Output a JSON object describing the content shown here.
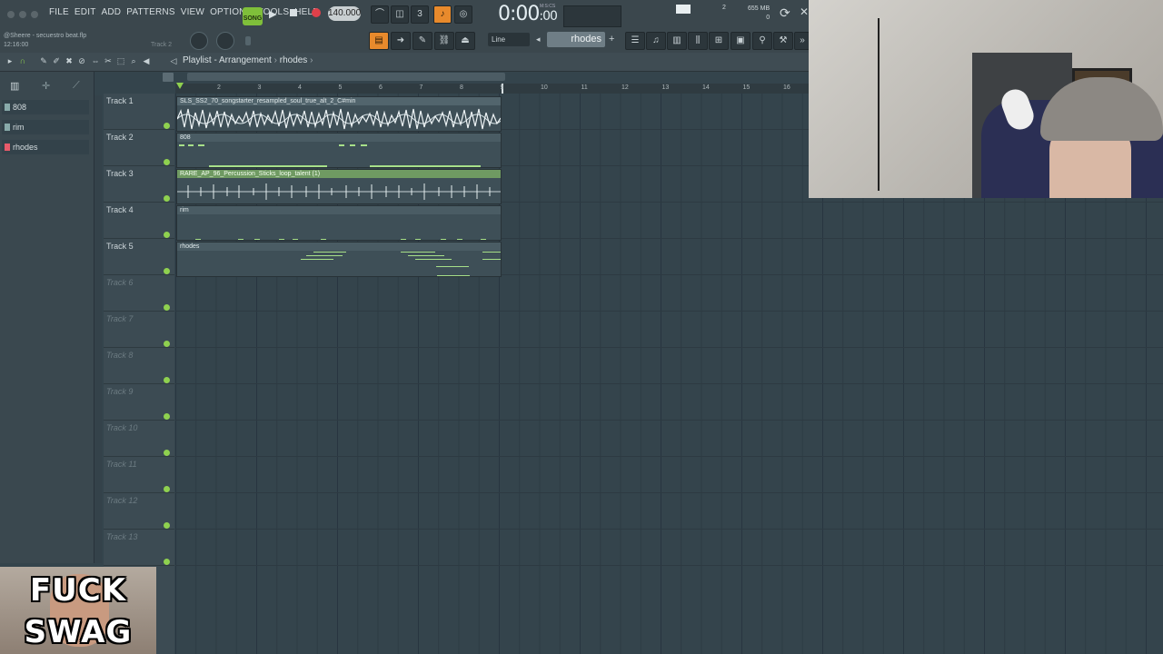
{
  "menu": [
    "FILE",
    "EDIT",
    "ADD",
    "PATTERNS",
    "VIEW",
    "OPTIONS",
    "TOOLS",
    "HELP"
  ],
  "transport": {
    "mode": "SONG",
    "tempo": "140.000",
    "time_main": "0:00",
    "time_sub": ":00",
    "time_unit": "M:S:CS"
  },
  "project": {
    "file": "@Sheere - secuestro beat.flp",
    "time": "12:16:00"
  },
  "hint_track": "Track 2",
  "snap": "Line",
  "pattern_selector": "rhodes",
  "resources": {
    "cpu_label": "2",
    "memory": "655 MB",
    "poly": "0"
  },
  "breadcrumb": {
    "root": "Playlist - Arrangement",
    "current": "rhodes"
  },
  "picker": [
    {
      "name": "808"
    },
    {
      "name": "rim"
    },
    {
      "name": "rhodes"
    }
  ],
  "ruler": [
    "2",
    "3",
    "4",
    "5",
    "6",
    "7",
    "8",
    "9",
    "10",
    "11",
    "12",
    "13",
    "14",
    "15",
    "16"
  ],
  "tracks": [
    {
      "label": "Track 1",
      "active": true
    },
    {
      "label": "Track 2",
      "active": true
    },
    {
      "label": "Track 3",
      "active": true
    },
    {
      "label": "Track 4",
      "active": true
    },
    {
      "label": "Track 5",
      "active": true
    },
    {
      "label": "Track 6",
      "active": false
    },
    {
      "label": "Track 7",
      "active": false
    },
    {
      "label": "Track 8",
      "active": false
    },
    {
      "label": "Track 9",
      "active": false
    },
    {
      "label": "Track 10",
      "active": false
    },
    {
      "label": "Track 11",
      "active": false
    },
    {
      "label": "Track 12",
      "active": false
    },
    {
      "label": "Track 13",
      "active": false
    }
  ],
  "clips": [
    {
      "title": "SLS_SS2_70_songstarter_resampled_soul_true_alt_2_C#min"
    },
    {
      "title": "808"
    },
    {
      "title": "RARE_AP_96_Percussion_Sticks_loop_talent (1)"
    },
    {
      "title": "rim"
    },
    {
      "title": "rhodes"
    }
  ],
  "overlay": {
    "line1": "FUCK",
    "line2": "SWAG"
  },
  "colors": {
    "accent_green": "#8fd14f",
    "grid_bg": "#34444c",
    "record": "#e0404a",
    "song_button": "#7fbf3a"
  }
}
